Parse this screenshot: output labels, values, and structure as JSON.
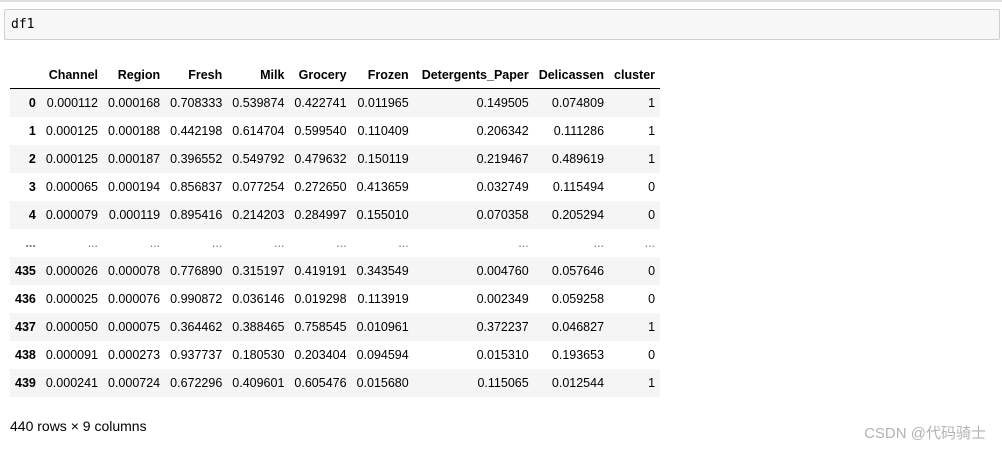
{
  "input": {
    "code": "df1"
  },
  "table": {
    "index_header": "",
    "columns": [
      "Channel",
      "Region",
      "Fresh",
      "Milk",
      "Grocery",
      "Frozen",
      "Detergents_Paper",
      "Delicassen",
      "cluster"
    ],
    "rows": [
      {
        "index": "0",
        "cells": [
          "0.000112",
          "0.000168",
          "0.708333",
          "0.539874",
          "0.422741",
          "0.011965",
          "0.149505",
          "0.074809",
          "1"
        ]
      },
      {
        "index": "1",
        "cells": [
          "0.000125",
          "0.000188",
          "0.442198",
          "0.614704",
          "0.599540",
          "0.110409",
          "0.206342",
          "0.111286",
          "1"
        ]
      },
      {
        "index": "2",
        "cells": [
          "0.000125",
          "0.000187",
          "0.396552",
          "0.549792",
          "0.479632",
          "0.150119",
          "0.219467",
          "0.489619",
          "1"
        ]
      },
      {
        "index": "3",
        "cells": [
          "0.000065",
          "0.000194",
          "0.856837",
          "0.077254",
          "0.272650",
          "0.413659",
          "0.032749",
          "0.115494",
          "0"
        ]
      },
      {
        "index": "4",
        "cells": [
          "0.000079",
          "0.000119",
          "0.895416",
          "0.214203",
          "0.284997",
          "0.155010",
          "0.070358",
          "0.205294",
          "0"
        ]
      },
      {
        "index": "...",
        "cells": [
          "...",
          "...",
          "...",
          "...",
          "...",
          "...",
          "...",
          "...",
          "..."
        ]
      },
      {
        "index": "435",
        "cells": [
          "0.000026",
          "0.000078",
          "0.776890",
          "0.315197",
          "0.419191",
          "0.343549",
          "0.004760",
          "0.057646",
          "0"
        ]
      },
      {
        "index": "436",
        "cells": [
          "0.000025",
          "0.000076",
          "0.990872",
          "0.036146",
          "0.019298",
          "0.113919",
          "0.002349",
          "0.059258",
          "0"
        ]
      },
      {
        "index": "437",
        "cells": [
          "0.000050",
          "0.000075",
          "0.364462",
          "0.388465",
          "0.758545",
          "0.010961",
          "0.372237",
          "0.046827",
          "1"
        ]
      },
      {
        "index": "438",
        "cells": [
          "0.000091",
          "0.000273",
          "0.937737",
          "0.180530",
          "0.203404",
          "0.094594",
          "0.015310",
          "0.193653",
          "0"
        ]
      },
      {
        "index": "439",
        "cells": [
          "0.000241",
          "0.000724",
          "0.672296",
          "0.409601",
          "0.605476",
          "0.015680",
          "0.115065",
          "0.012544",
          "1"
        ]
      }
    ]
  },
  "summary": "440 rows × 9 columns",
  "watermark": "CSDN @代码骑士"
}
